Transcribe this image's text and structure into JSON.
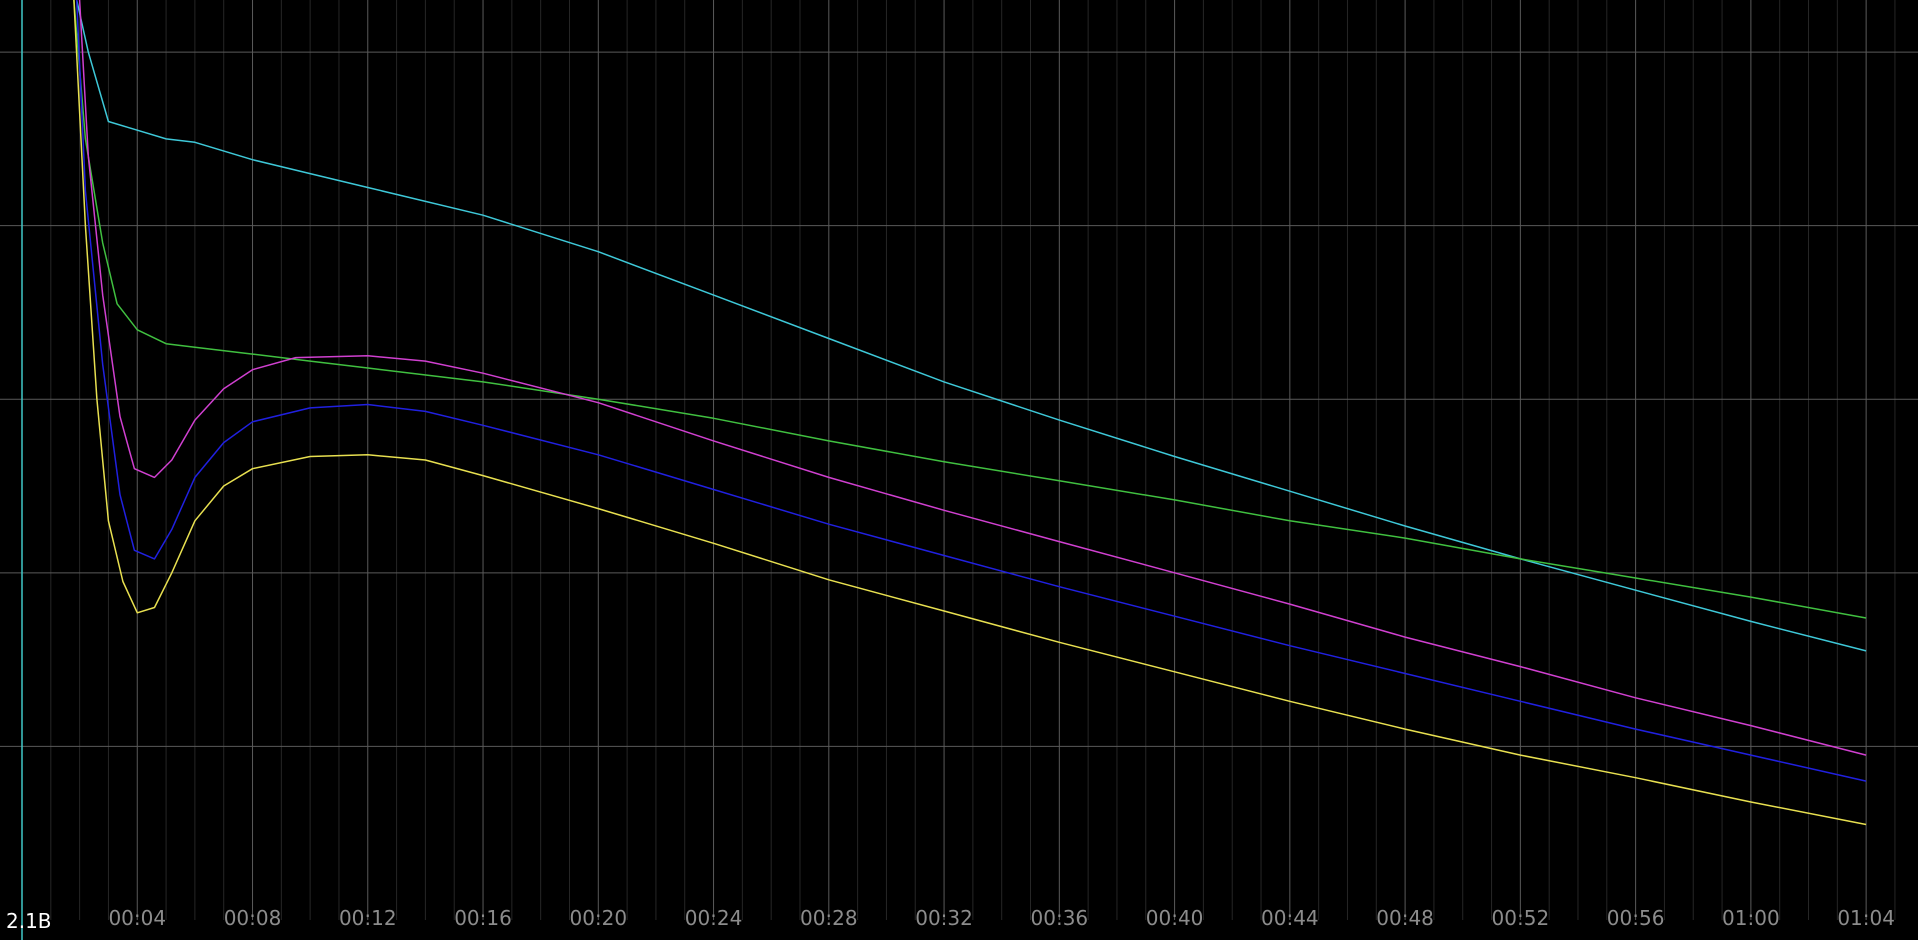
{
  "chart_data": {
    "type": "line",
    "title": "",
    "xlabel": "",
    "ylabel": "",
    "grid": true,
    "background_color": "#000000",
    "grid_major_color": "#5a5a5a",
    "grid_minor_color": "#262626",
    "cursor_color": "#40c8c8",
    "xlim": [
      0,
      65.8
    ],
    "ylim": [
      0,
      5.3
    ],
    "x_tick_values": [
      4,
      8,
      12,
      16,
      20,
      24,
      28,
      32,
      36,
      40,
      44,
      48,
      52,
      56,
      60,
      64
    ],
    "x_tick_labels": [
      "00:04",
      "00:08",
      "00:12",
      "00:16",
      "00:20",
      "00:24",
      "00:28",
      "00:32",
      "00:36",
      "00:40",
      "00:44",
      "00:48",
      "00:52",
      "00:56",
      "01:00",
      "01:04"
    ],
    "level_label": "2.1B",
    "series": [
      {
        "color": "#3ec8d8",
        "points": [
          [
            1.9,
            5.3
          ],
          [
            2.3,
            5.0
          ],
          [
            3.0,
            4.6
          ],
          [
            4.0,
            4.55
          ],
          [
            5.0,
            4.5
          ],
          [
            6.0,
            4.48
          ],
          [
            8.0,
            4.38
          ],
          [
            10.0,
            4.3
          ],
          [
            12.0,
            4.22
          ],
          [
            16.0,
            4.06
          ],
          [
            20.0,
            3.85
          ],
          [
            24.0,
            3.6
          ],
          [
            28.0,
            3.35
          ],
          [
            32.0,
            3.1
          ],
          [
            36.0,
            2.88
          ],
          [
            40.0,
            2.67
          ],
          [
            44.0,
            2.47
          ],
          [
            48.0,
            2.27
          ],
          [
            52.0,
            2.08
          ],
          [
            56.0,
            1.9
          ],
          [
            60.0,
            1.72
          ],
          [
            64.0,
            1.55
          ]
        ]
      },
      {
        "color": "#40c040",
        "points": [
          [
            1.8,
            5.3
          ],
          [
            2.2,
            4.5
          ],
          [
            2.8,
            3.9
          ],
          [
            3.3,
            3.55
          ],
          [
            4.0,
            3.4
          ],
          [
            5.0,
            3.32
          ],
          [
            6.0,
            3.3
          ],
          [
            8.0,
            3.26
          ],
          [
            10.0,
            3.22
          ],
          [
            12.0,
            3.18
          ],
          [
            16.0,
            3.1
          ],
          [
            20.0,
            3.0
          ],
          [
            24.0,
            2.89
          ],
          [
            28.0,
            2.76
          ],
          [
            32.0,
            2.64
          ],
          [
            36.0,
            2.53
          ],
          [
            40.0,
            2.42
          ],
          [
            44.0,
            2.3
          ],
          [
            48.0,
            2.2
          ],
          [
            52.0,
            2.08
          ],
          [
            56.0,
            1.97
          ],
          [
            60.0,
            1.86
          ],
          [
            64.0,
            1.74
          ]
        ]
      },
      {
        "color": "#d040d0",
        "points": [
          [
            2.0,
            5.3
          ],
          [
            2.3,
            4.4
          ],
          [
            2.8,
            3.6
          ],
          [
            3.4,
            2.9
          ],
          [
            3.9,
            2.6
          ],
          [
            4.6,
            2.55
          ],
          [
            5.2,
            2.65
          ],
          [
            6.0,
            2.88
          ],
          [
            7.0,
            3.06
          ],
          [
            8.0,
            3.17
          ],
          [
            9.5,
            3.24
          ],
          [
            12.0,
            3.25
          ],
          [
            14.0,
            3.22
          ],
          [
            16.0,
            3.15
          ],
          [
            20.0,
            2.98
          ],
          [
            24.0,
            2.76
          ],
          [
            28.0,
            2.55
          ],
          [
            32.0,
            2.36
          ],
          [
            36.0,
            2.18
          ],
          [
            40.0,
            2.0
          ],
          [
            44.0,
            1.82
          ],
          [
            48.0,
            1.63
          ],
          [
            52.0,
            1.46
          ],
          [
            56.0,
            1.28
          ],
          [
            60.0,
            1.12
          ],
          [
            64.0,
            0.95
          ]
        ]
      },
      {
        "color": "#2020e0",
        "points": [
          [
            1.9,
            5.3
          ],
          [
            2.2,
            4.2
          ],
          [
            2.8,
            3.2
          ],
          [
            3.4,
            2.45
          ],
          [
            3.9,
            2.13
          ],
          [
            4.6,
            2.08
          ],
          [
            5.2,
            2.25
          ],
          [
            6.0,
            2.55
          ],
          [
            7.0,
            2.75
          ],
          [
            8.0,
            2.87
          ],
          [
            10.0,
            2.95
          ],
          [
            12.0,
            2.97
          ],
          [
            14.0,
            2.93
          ],
          [
            16.0,
            2.85
          ],
          [
            20.0,
            2.68
          ],
          [
            24.0,
            2.48
          ],
          [
            28.0,
            2.28
          ],
          [
            32.0,
            2.1
          ],
          [
            36.0,
            1.92
          ],
          [
            40.0,
            1.75
          ],
          [
            44.0,
            1.58
          ],
          [
            48.0,
            1.42
          ],
          [
            52.0,
            1.26
          ],
          [
            56.0,
            1.1
          ],
          [
            60.0,
            0.95
          ],
          [
            64.0,
            0.8
          ]
        ]
      },
      {
        "color": "#e8e050",
        "points": [
          [
            1.8,
            5.3
          ],
          [
            2.2,
            4.0
          ],
          [
            2.6,
            3.0
          ],
          [
            3.0,
            2.3
          ],
          [
            3.5,
            1.95
          ],
          [
            4.0,
            1.77
          ],
          [
            4.6,
            1.8
          ],
          [
            5.2,
            2.0
          ],
          [
            6.0,
            2.3
          ],
          [
            7.0,
            2.5
          ],
          [
            8.0,
            2.6
          ],
          [
            10.0,
            2.67
          ],
          [
            12.0,
            2.68
          ],
          [
            14.0,
            2.65
          ],
          [
            16.0,
            2.56
          ],
          [
            20.0,
            2.37
          ],
          [
            24.0,
            2.17
          ],
          [
            28.0,
            1.96
          ],
          [
            32.0,
            1.78
          ],
          [
            36.0,
            1.6
          ],
          [
            40.0,
            1.43
          ],
          [
            44.0,
            1.26
          ],
          [
            48.0,
            1.1
          ],
          [
            52.0,
            0.95
          ],
          [
            56.0,
            0.82
          ],
          [
            60.0,
            0.68
          ],
          [
            64.0,
            0.55
          ]
        ]
      }
    ]
  }
}
